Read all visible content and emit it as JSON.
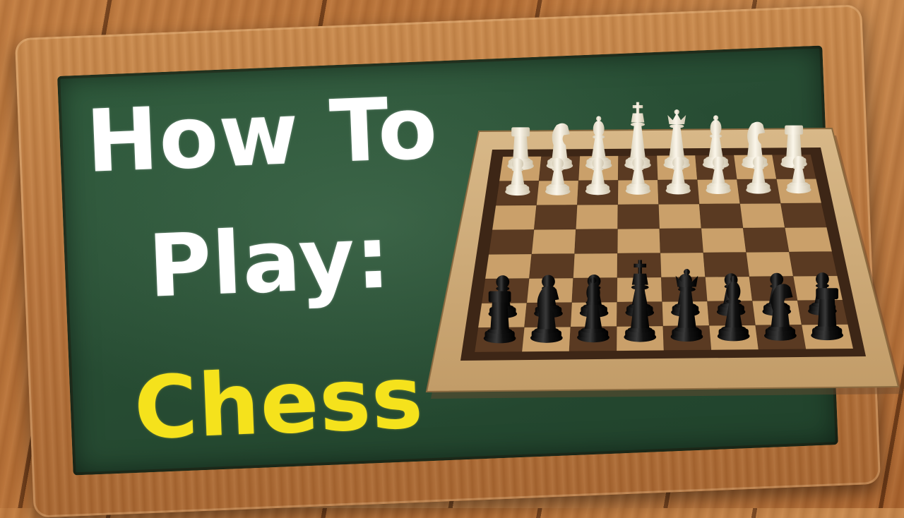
{
  "title": {
    "line1": "How To",
    "line2": "Play:",
    "line3": "Chess"
  },
  "colors": {
    "chalk_white": "#ffffff",
    "chalk_yellow": "#f5e21c",
    "chalkboard": "#274c33",
    "frame_wood": "#b8733a",
    "light_square": "#caa06a",
    "dark_square": "#5a3a22",
    "white_piece": "#efe7d4",
    "black_piece": "#141414"
  },
  "icons": {
    "white_pieces": [
      "rook",
      "knight",
      "bishop",
      "king",
      "queen",
      "bishop",
      "knight",
      "rook"
    ],
    "black_pieces": [
      "rook",
      "knight",
      "bishop",
      "king",
      "queen",
      "bishop",
      "knight",
      "rook"
    ]
  }
}
